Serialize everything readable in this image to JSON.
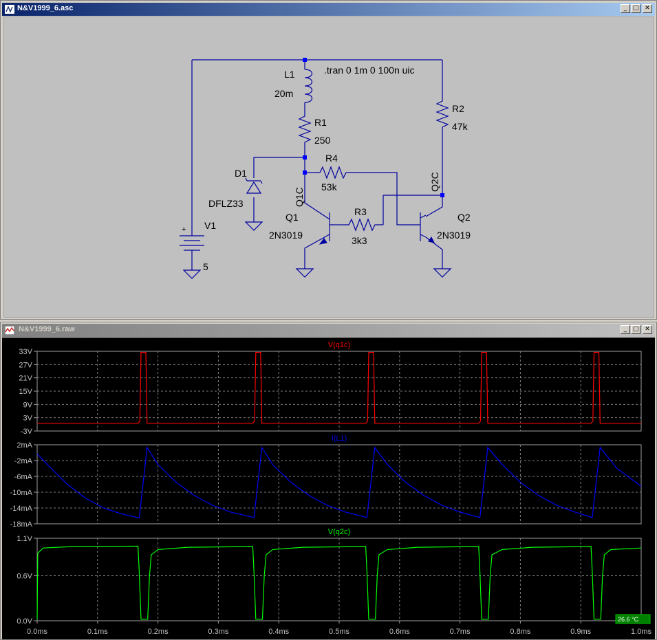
{
  "schematic_window": {
    "title": "N&V1999_6.asc",
    "buttons": {
      "minimize": "_",
      "restore": "□",
      "close": "✕"
    },
    "directive": ".tran 0 1m 0 100n uic",
    "components": {
      "L1": {
        "ref": "L1",
        "value": "20m"
      },
      "R1": {
        "ref": "R1",
        "value": "250"
      },
      "R2": {
        "ref": "R2",
        "value": "47k"
      },
      "R3": {
        "ref": "R3",
        "value": "3k3"
      },
      "R4": {
        "ref": "R4",
        "value": "53k"
      },
      "D1": {
        "ref": "D1",
        "value": "DFLZ33"
      },
      "Q1": {
        "ref": "Q1",
        "value": "2N3019"
      },
      "Q2": {
        "ref": "Q2",
        "value": "2N3019"
      },
      "V1": {
        "ref": "V1",
        "value": "5",
        "plus": "+"
      }
    },
    "net_labels": {
      "q1c": "Q1C",
      "q2c": "Q2C"
    }
  },
  "waveform_window": {
    "title": "N&V1999_6.raw",
    "buttons": {
      "minimize": "_",
      "restore": "□",
      "close": "✕"
    },
    "temperature": "26.6 °C",
    "x_ticks": [
      "0.0ms",
      "0.1ms",
      "0.2ms",
      "0.3ms",
      "0.4ms",
      "0.5ms",
      "0.6ms",
      "0.7ms",
      "0.8ms",
      "0.9ms",
      "1.0ms"
    ],
    "colors": {
      "red": "#ff0000",
      "blue": "#0000ff",
      "green": "#00ff00",
      "grid": "#808080"
    }
  },
  "chart_data": [
    {
      "type": "line",
      "title": "V(q1c)",
      "xlim": [
        0,
        1.0
      ],
      "ylim": [
        -3,
        33
      ],
      "y_ticks": [
        "33V",
        "27V",
        "21V",
        "15V",
        "9V",
        "3V",
        "-3V"
      ],
      "y_tick_values": [
        33,
        27,
        21,
        15,
        9,
        3,
        -3
      ],
      "series": [
        {
          "name": "V(q1c)",
          "color": "#ff0000",
          "points": [
            [
              0,
              0.5
            ],
            [
              0.167,
              0.5
            ],
            [
              0.17,
              1.5
            ],
            [
              0.172,
              32.5
            ],
            [
              0.18,
              32.5
            ],
            [
              0.182,
              0.5
            ],
            [
              0.357,
              0.5
            ],
            [
              0.36,
              1.5
            ],
            [
              0.362,
              32.5
            ],
            [
              0.37,
              32.5
            ],
            [
              0.372,
              0.5
            ],
            [
              0.544,
              0.5
            ],
            [
              0.547,
              1.5
            ],
            [
              0.549,
              32.5
            ],
            [
              0.557,
              32.5
            ],
            [
              0.559,
              0.5
            ],
            [
              0.731,
              0.5
            ],
            [
              0.734,
              1.5
            ],
            [
              0.736,
              32.5
            ],
            [
              0.744,
              32.5
            ],
            [
              0.746,
              0.5
            ],
            [
              0.917,
              0.5
            ],
            [
              0.92,
              1.5
            ],
            [
              0.922,
              32.5
            ],
            [
              0.93,
              32.5
            ],
            [
              0.932,
              0.5
            ],
            [
              1.0,
              0.5
            ]
          ]
        }
      ]
    },
    {
      "type": "line",
      "title": "I(L1)",
      "xlim": [
        0,
        1.0
      ],
      "ylim": [
        -18,
        2
      ],
      "y_ticks": [
        "2mA",
        "-2mA",
        "-6mA",
        "-10mA",
        "-14mA",
        "-18mA"
      ],
      "y_tick_values": [
        2,
        -2,
        -6,
        -10,
        -14,
        -18
      ],
      "series": [
        {
          "name": "I(L1)",
          "color": "#0000ff",
          "points": [
            [
              0,
              -0.3
            ],
            [
              0.02,
              -3.5
            ],
            [
              0.05,
              -8
            ],
            [
              0.08,
              -11.5
            ],
            [
              0.11,
              -14
            ],
            [
              0.14,
              -15.5
            ],
            [
              0.169,
              -16.5
            ],
            [
              0.182,
              1.3
            ],
            [
              0.2,
              -3
            ],
            [
              0.23,
              -7.5
            ],
            [
              0.26,
              -10.8
            ],
            [
              0.29,
              -13.3
            ],
            [
              0.32,
              -15
            ],
            [
              0.359,
              -16.4
            ],
            [
              0.372,
              1.3
            ],
            [
              0.39,
              -3
            ],
            [
              0.42,
              -7.5
            ],
            [
              0.45,
              -10.8
            ],
            [
              0.48,
              -13.3
            ],
            [
              0.51,
              -15
            ],
            [
              0.546,
              -16.4
            ],
            [
              0.559,
              1.3
            ],
            [
              0.58,
              -3
            ],
            [
              0.61,
              -7.5
            ],
            [
              0.64,
              -10.8
            ],
            [
              0.67,
              -13.3
            ],
            [
              0.7,
              -15
            ],
            [
              0.733,
              -16.4
            ],
            [
              0.746,
              1.3
            ],
            [
              0.77,
              -3
            ],
            [
              0.8,
              -7.5
            ],
            [
              0.83,
              -10.8
            ],
            [
              0.86,
              -13.3
            ],
            [
              0.89,
              -15
            ],
            [
              0.919,
              -16.4
            ],
            [
              0.932,
              1.3
            ],
            [
              0.96,
              -4
            ],
            [
              1.0,
              -8.5
            ]
          ]
        }
      ]
    },
    {
      "type": "line",
      "title": "V(q2c)",
      "xlim": [
        0,
        1.0
      ],
      "ylim": [
        0,
        1.1
      ],
      "y_ticks": [
        "1.1V",
        "0.6V",
        "0.0V"
      ],
      "y_tick_values": [
        1.1,
        0.6,
        0.0
      ],
      "series": [
        {
          "name": "V(q2c)",
          "color": "#00ff00",
          "points": [
            [
              0,
              0.02
            ],
            [
              0.001,
              0.9
            ],
            [
              0.01,
              0.97
            ],
            [
              0.06,
              0.99
            ],
            [
              0.167,
              0.995
            ],
            [
              0.169,
              0.65
            ],
            [
              0.172,
              0.02
            ],
            [
              0.183,
              0.02
            ],
            [
              0.186,
              0.6
            ],
            [
              0.189,
              0.88
            ],
            [
              0.2,
              0.95
            ],
            [
              0.25,
              0.98
            ],
            [
              0.357,
              0.99
            ],
            [
              0.359,
              0.65
            ],
            [
              0.362,
              0.02
            ],
            [
              0.373,
              0.02
            ],
            [
              0.376,
              0.6
            ],
            [
              0.379,
              0.88
            ],
            [
              0.39,
              0.95
            ],
            [
              0.44,
              0.98
            ],
            [
              0.544,
              0.99
            ],
            [
              0.546,
              0.65
            ],
            [
              0.549,
              0.02
            ],
            [
              0.56,
              0.02
            ],
            [
              0.563,
              0.6
            ],
            [
              0.566,
              0.88
            ],
            [
              0.58,
              0.95
            ],
            [
              0.63,
              0.98
            ],
            [
              0.731,
              0.99
            ],
            [
              0.733,
              0.65
            ],
            [
              0.736,
              0.02
            ],
            [
              0.747,
              0.02
            ],
            [
              0.75,
              0.6
            ],
            [
              0.753,
              0.88
            ],
            [
              0.77,
              0.95
            ],
            [
              0.82,
              0.98
            ],
            [
              0.917,
              0.99
            ],
            [
              0.919,
              0.65
            ],
            [
              0.922,
              0.02
            ],
            [
              0.933,
              0.02
            ],
            [
              0.936,
              0.6
            ],
            [
              0.939,
              0.88
            ],
            [
              0.95,
              0.95
            ],
            [
              1.0,
              0.97
            ]
          ]
        }
      ]
    }
  ]
}
